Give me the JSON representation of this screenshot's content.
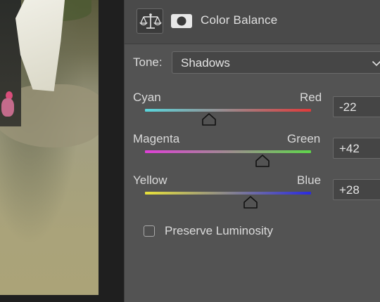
{
  "panel": {
    "title": "Color Balance",
    "header_icons": [
      "balance-scale-icon",
      "layer-mask-icon"
    ]
  },
  "tone": {
    "label": "Tone:",
    "selected": "Shadows"
  },
  "sliders": [
    {
      "left_label": "Cyan",
      "right_label": "Red",
      "value": "-22",
      "from_color": "#58d6dc",
      "to_color": "#e03a3a"
    },
    {
      "left_label": "Magenta",
      "right_label": "Green",
      "value": "+42",
      "from_color": "#e040d8",
      "to_color": "#5fd84a"
    },
    {
      "left_label": "Yellow",
      "right_label": "Blue",
      "value": "+28",
      "from_color": "#e8e23a",
      "to_color": "#2a2ae0"
    }
  ],
  "preserve_luminosity": {
    "label": "Preserve Luminosity",
    "checked": false
  }
}
